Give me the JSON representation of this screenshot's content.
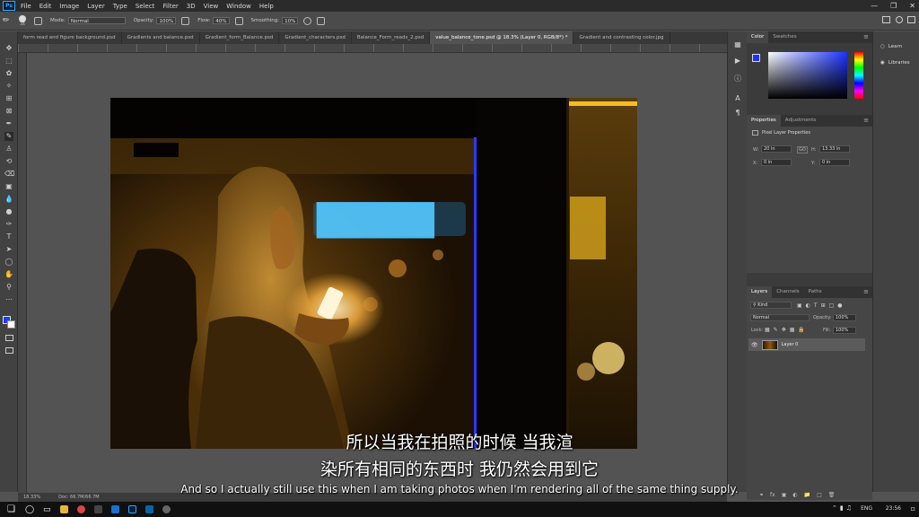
{
  "app": {
    "logo": "Ps"
  },
  "menu": [
    "File",
    "Edit",
    "Image",
    "Layer",
    "Type",
    "Select",
    "Filter",
    "3D",
    "View",
    "Window",
    "Help"
  ],
  "options": {
    "brush_size": "34",
    "mode_label": "Mode:",
    "mode_value": "Normal",
    "opacity_label": "Opacity:",
    "opacity_value": "100%",
    "flow_label": "Flow:",
    "flow_value": "40%",
    "smoothing_label": "Smoothing:",
    "smoothing_value": "10%"
  },
  "tabs": [
    {
      "label": "form read and figure background.psd"
    },
    {
      "label": "Gradients and balance.psd"
    },
    {
      "label": "Gradient_form_Balance.psd"
    },
    {
      "label": "Gradient_characters.psd"
    },
    {
      "label": "Balance_Form_reads_2.psd"
    },
    {
      "label": "value_balance_tone.psd @ 18.3% (Layer 0, RGB/8*) *",
      "active": true
    },
    {
      "label": "Gradient and contrasting color.jpg"
    }
  ],
  "status": {
    "zoom": "18.33%",
    "doc": "Doc: 66.7M/66.7M"
  },
  "color_panel": {
    "tab_color": "Color",
    "tab_swatches": "Swatches",
    "foreground": "#1a33ff",
    "background": "#ffffff"
  },
  "properties_panel": {
    "tab_properties": "Properties",
    "tab_adjustments": "Adjustments",
    "heading": "Pixel Layer Properties",
    "w_label": "W:",
    "w_value": "20 in",
    "h_label": "H:",
    "h_value": "13.33 in",
    "x_label": "X:",
    "x_value": "0 in",
    "y_label": "Y:",
    "y_value": "0 in",
    "link_label": "GO"
  },
  "layers_panel": {
    "tab_layers": "Layers",
    "tab_channels": "Channels",
    "tab_paths": "Paths",
    "kind_label": "Kind",
    "blend_mode": "Normal",
    "opacity_label": "Opacity:",
    "opacity_value": "100%",
    "lock_label": "Lock:",
    "fill_label": "Fill:",
    "fill_value": "100%",
    "layers": [
      {
        "name": "Layer 0"
      }
    ]
  },
  "far_panel": {
    "learn": "Learn",
    "libraries": "Libraries"
  },
  "subtitles": {
    "cn_line1": "所以当我在拍照的时候 当我渲",
    "cn_line2": "染所有相同的东西时 我仍然会用到它",
    "en_line": "And so I actually still use this when I am taking photos when I'm rendering all of the same thing supply."
  },
  "taskbar": {
    "lang": "ENG",
    "time": "23:56"
  }
}
